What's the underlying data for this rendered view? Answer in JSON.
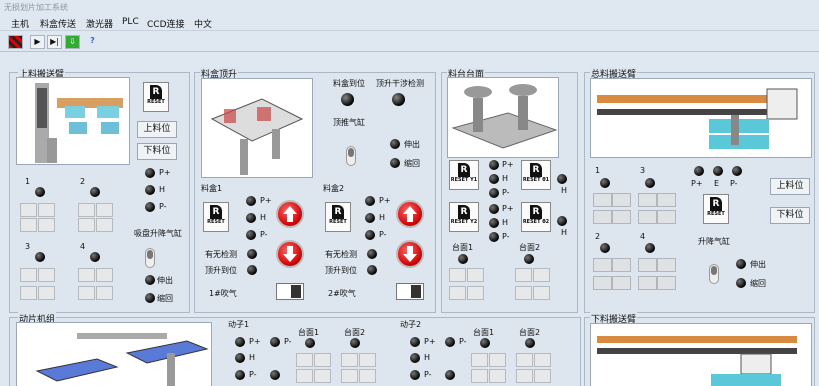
{
  "window": {
    "title": "无损划片加工系统"
  },
  "menu": [
    "主机",
    "料盒传送",
    "激光器",
    "PLC",
    "CCD连接",
    "中文"
  ],
  "toolbar": {
    "icons": [
      "stop-icon",
      "play-icon",
      "step-icon",
      "save-icon",
      "help-icon"
    ]
  },
  "panels": {
    "upper_arm": {
      "title": "上料搬送臂",
      "reset": "RESET",
      "btn1": "上料位",
      "btn2": "下料位",
      "p_plus": "P+",
      "h": "H",
      "p_minus": "P-",
      "suction": "吸盘升降气缸",
      "n1": "1",
      "n2": "2",
      "n3": "3",
      "n4": "4",
      "extend": "伸出",
      "retract": "缩回"
    },
    "box_lift": {
      "title": "料盒顶升",
      "box_pos": "料盒到位",
      "top_check": "顶升干涉检测",
      "push_cyl": "顶推气缸",
      "extend": "伸出",
      "retract": "缩回",
      "box1": "料盒1",
      "box2": "料盒2",
      "reset": "RESET",
      "p_plus": "P+",
      "h": "H",
      "p_minus": "P-",
      "has1": "有无检测",
      "top1": "顶升到位",
      "has2": "有无检测",
      "top2": "顶升到位",
      "air1": "1#吹气",
      "air2": "2#吹气"
    },
    "worktable": {
      "title": "料台台面",
      "reset_y1": "RESET Y1",
      "reset_t1": "RESET θ1",
      "reset_y2": "RESET Y2",
      "reset_t2": "RESET θ2",
      "p_plus": "P+",
      "h": "H",
      "p_minus": "P-",
      "table1": "台面1",
      "table2": "台面2"
    },
    "main_arm": {
      "title": "总料搬送臂",
      "n1": "1",
      "n3": "3",
      "n2": "2",
      "n4": "4",
      "p_plus": "P+",
      "e": "E",
      "p_minus": "P-",
      "reset": "RESET",
      "btn1": "上料位",
      "btn2": "下料位",
      "lift": "升降气缸",
      "extend": "伸出",
      "retract": "缩回"
    },
    "chip": {
      "title": "动片机组",
      "motor1": "动子1",
      "motor2": "动子2",
      "table1": "台面1",
      "table2": "台面2",
      "p_plus": "P+",
      "h": "H",
      "p_minus": "P-"
    },
    "lower_arm": {
      "title": "下料搬送臂"
    }
  }
}
